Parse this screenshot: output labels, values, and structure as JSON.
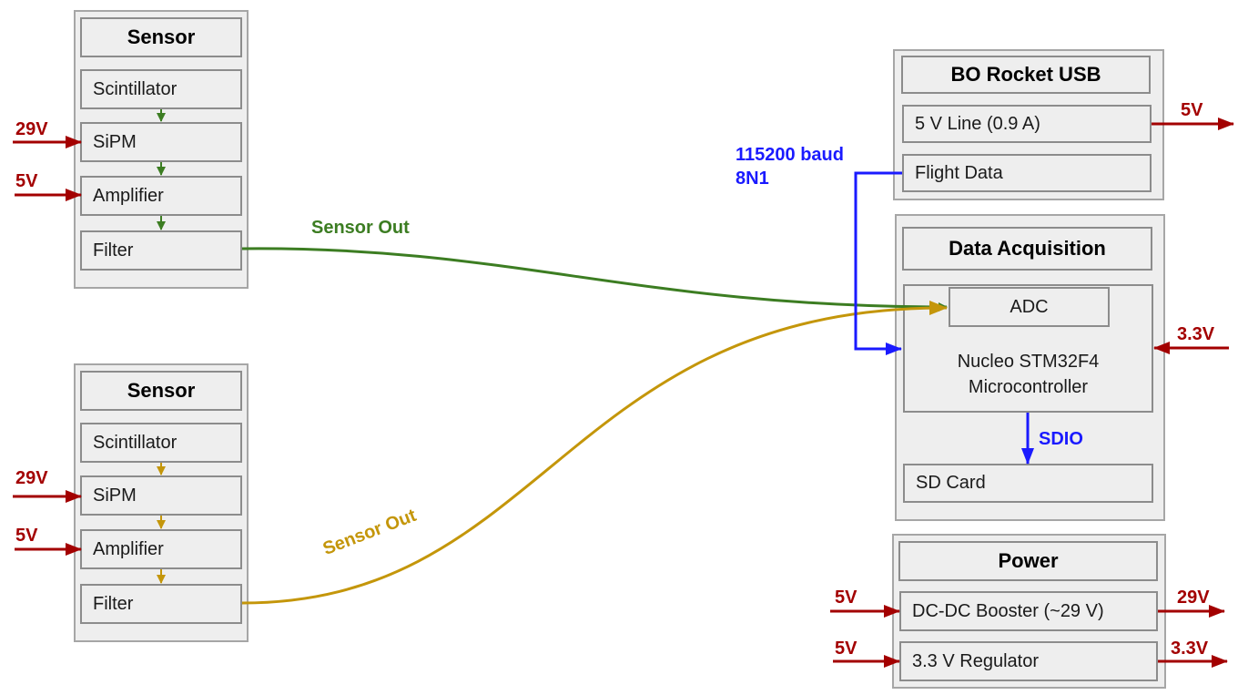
{
  "colors": {
    "power": "#a30000",
    "data": "#1a1aff",
    "sensor1": "#3c7d22",
    "sensor2": "#c4960a"
  },
  "sensor1": {
    "title": "Sensor",
    "stages": [
      "Scintillator",
      "SiPM",
      "Amplifier",
      "Filter"
    ],
    "sipm_input": "29V",
    "amp_input": "5V",
    "output_label": "Sensor Out"
  },
  "sensor2": {
    "title": "Sensor",
    "stages": [
      "Scintillator",
      "SiPM",
      "Amplifier",
      "Filter"
    ],
    "sipm_input": "29V",
    "amp_input": "5V",
    "output_label": "Sensor Out"
  },
  "usb": {
    "title": "BO Rocket USB",
    "line": "5 V Line (0.9 A)",
    "line_output": "5V",
    "flight_data": "Flight Data"
  },
  "serial": {
    "line1": "115200 baud",
    "line2": "8N1"
  },
  "daq": {
    "title": "Data Acquisition",
    "adc": "ADC",
    "mcu_line1": "Nucleo STM32F4",
    "mcu_line2": "Microcontroller",
    "mcu_input": "3.3V",
    "bus": "SDIO",
    "sd": "SD Card"
  },
  "power": {
    "title": "Power",
    "booster": "DC-DC Booster (~29 V)",
    "booster_input": "5V",
    "booster_output": "29V",
    "regulator": "3.3 V Regulator",
    "regulator_input": "5V",
    "regulator_output": "3.3V"
  }
}
